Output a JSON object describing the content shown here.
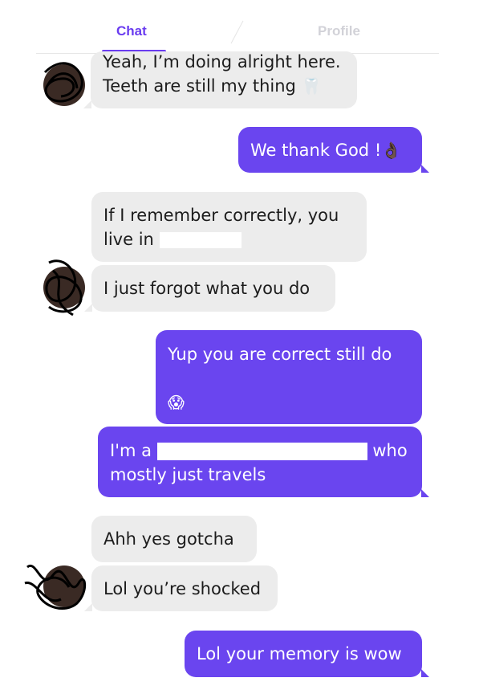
{
  "tabs": {
    "chat": "Chat",
    "profile": "Profile"
  },
  "messages": [
    {
      "line1": "Yeah, I’m doing alright here.",
      "line2": "Teeth are still my thing",
      "emoji": "🦷"
    },
    {
      "text": "We thank God !",
      "emoji": "👌🏿"
    },
    {
      "line1": "If I remember correctly, you",
      "line2": "live in"
    },
    {
      "text": "I just forgot what you do"
    },
    {
      "text": "Yup you are correct still do",
      "emoji": "😱"
    },
    {
      "prefix": "I'm a",
      "suffix": "who",
      "line2": "mostly just travels"
    },
    {
      "text": "Ahh yes gotcha"
    },
    {
      "text": "Lol you’re shocked"
    },
    {
      "text": "Lol your memory is wow"
    }
  ]
}
